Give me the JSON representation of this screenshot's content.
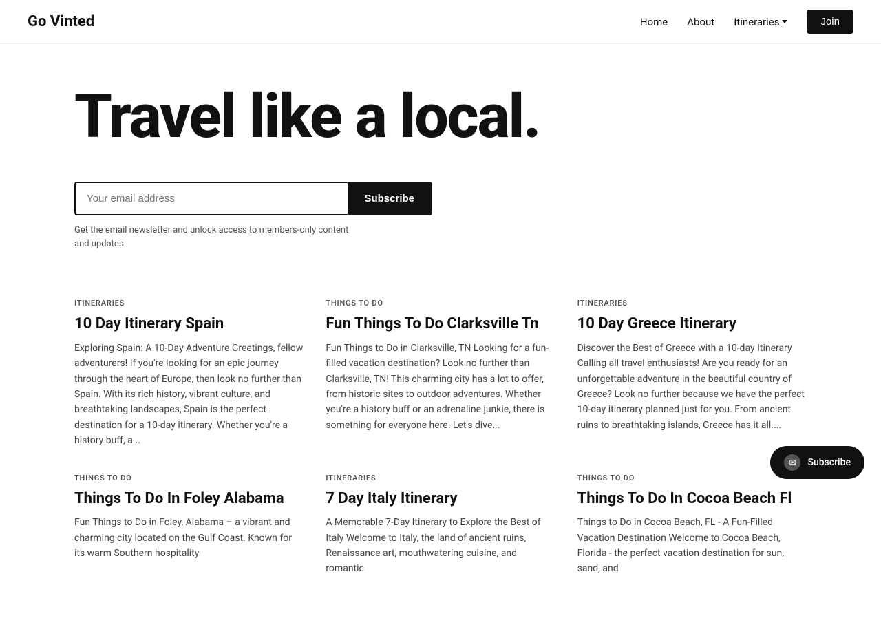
{
  "nav": {
    "logo": "Go Vinted",
    "links": [
      {
        "id": "home",
        "label": "Home"
      },
      {
        "id": "about",
        "label": "About"
      },
      {
        "id": "itineraries",
        "label": "Itineraries",
        "hasDropdown": true
      }
    ],
    "join_label": "Join"
  },
  "hero": {
    "title": "Travel like a local.",
    "email_placeholder": "Your email address",
    "subscribe_label": "Subscribe",
    "desc": "Get the email newsletter and unlock access to members-only content and updates"
  },
  "cards": [
    {
      "tag": "Itineraries",
      "title": "10 Day Itinerary Spain",
      "excerpt": "Exploring Spain: A 10-Day Adventure Greetings, fellow adventurers! If you're looking for an epic journey through the heart of Europe, then look no further than Spain. With its rich history, vibrant culture, and breathtaking landscapes, Spain is the perfect destination for a 10-day itinerary. Whether you're a history buff, a..."
    },
    {
      "tag": "Things to do",
      "title": "Fun Things To Do Clarksville Tn",
      "excerpt": "Fun Things to Do in Clarksville, TN Looking for a fun-filled vacation destination? Look no further than Clarksville, TN! This charming city has a lot to offer, from historic sites to outdoor adventures. Whether you're a history buff or an adrenaline junkie, there is something for everyone here. Let's dive..."
    },
    {
      "tag": "Itineraries",
      "title": "10 Day Greece Itinerary",
      "excerpt": "Discover the Best of Greece with a 10-day Itinerary Calling all travel enthusiasts! Are you ready for an unforgettable adventure in the beautiful country of Greece? Look no further because we have the perfect 10-day itinerary planned just for you. From ancient ruins to breathtaking islands, Greece has it all...."
    },
    {
      "tag": "Things to do",
      "title": "Things To Do In Foley Alabama",
      "excerpt": "Fun Things to Do in Foley, Alabama – a vibrant and charming city located on the Gulf Coast. Known for its warm Southern hospitality"
    },
    {
      "tag": "Itineraries",
      "title": "7 Day Italy Itinerary",
      "excerpt": "A Memorable 7-Day Itinerary to Explore the Best of Italy Welcome to Italy, the land of ancient ruins, Renaissance art, mouthwatering cuisine, and romantic"
    },
    {
      "tag": "Things to do",
      "title": "Things To Do In Cocoa Beach Fl",
      "excerpt": "Things to Do in Cocoa Beach, FL - A Fun-Filled Vacation Destination Welcome to Cocoa Beach, Florida - the perfect vacation destination for sun, sand, and"
    }
  ],
  "toast": {
    "label": "Subscribe",
    "icon": "✉"
  }
}
